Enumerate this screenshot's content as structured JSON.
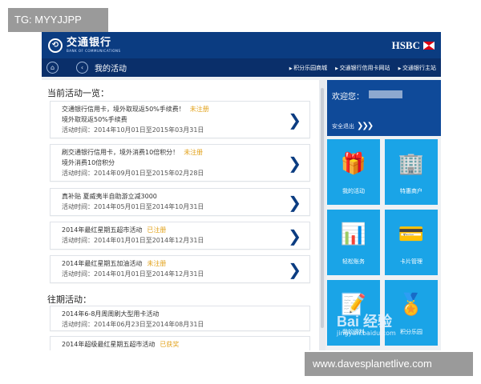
{
  "watermark_tag": "TG: MYYJJPP",
  "watermark_site": "www.davesplanetlive.com",
  "baidu": {
    "logo": "Bai 经验",
    "url": "jingyan.baidu.com"
  },
  "header": {
    "brand_cn": "交通银行",
    "brand_en": "BANK OF COMMUNICATIONS",
    "partner": "HSBC"
  },
  "navbar": {
    "title": "我的活动",
    "links": [
      "积分乐园商城",
      "交通银行信用卡网站",
      "交通银行主站"
    ]
  },
  "current": {
    "heading": "当前活动一览：",
    "items": [
      {
        "title": "交通银行信用卡，境外取现返50%手续费！",
        "tag": "未注册",
        "sub": "境外取现返50%手续费",
        "time": "活动时间：2014年10月01日至2015年03月31日"
      },
      {
        "title": "刷交通银行信用卡，境外消费10倍积分！",
        "tag": "未注册",
        "sub": "境外消费10倍积分",
        "time": "活动时间：2014年09月01日至2015年02月28日"
      },
      {
        "title": "真补贴 夏威夷半自助游立减3000",
        "tag": "",
        "sub": "",
        "time": "活动时间：2014年05月01日至2014年10月31日"
      },
      {
        "title": "2014年最红星期五超市活动",
        "tag": "已注册",
        "sub": "",
        "time": "活动时间：2014年01月01日至2014年12月31日"
      },
      {
        "title": "2014年最红星期五加油活动",
        "tag": "未注册",
        "sub": "",
        "time": "活动时间：2014年01月01日至2014年12月31日"
      }
    ]
  },
  "past": {
    "heading": "往期活动：",
    "items": [
      {
        "title": "2014年6-8月周周刷大型用卡活动",
        "tag": "",
        "time": "活动时间：2014年06月23日至2014年08月31日"
      },
      {
        "title": "2014年超级最红星期五超市活动",
        "tag": "已获奖",
        "time": ""
      }
    ]
  },
  "sidebar": {
    "welcome": "欢迎您：",
    "logout": "安全退出",
    "tiles": [
      {
        "label": "我的活动",
        "icon": "gift-icon",
        "glyph": "🎁"
      },
      {
        "label": "特惠商户",
        "icon": "building-icon",
        "glyph": "🏢"
      },
      {
        "label": "轻松账务",
        "icon": "bar-chart-icon",
        "glyph": "📊"
      },
      {
        "label": "卡片管理",
        "icon": "cards-icon",
        "glyph": "💳"
      },
      {
        "label": "我的资料",
        "icon": "document-edit-icon",
        "glyph": "📝"
      },
      {
        "label": "积分乐园",
        "icon": "medal-icon",
        "glyph": "🏅"
      }
    ]
  },
  "colors": {
    "header": "#0b3c81",
    "navbar": "#0a2f6a",
    "tile": "#1aa4e7",
    "accent_tag": "#e2a21b",
    "chevron": "#0b3c81"
  }
}
